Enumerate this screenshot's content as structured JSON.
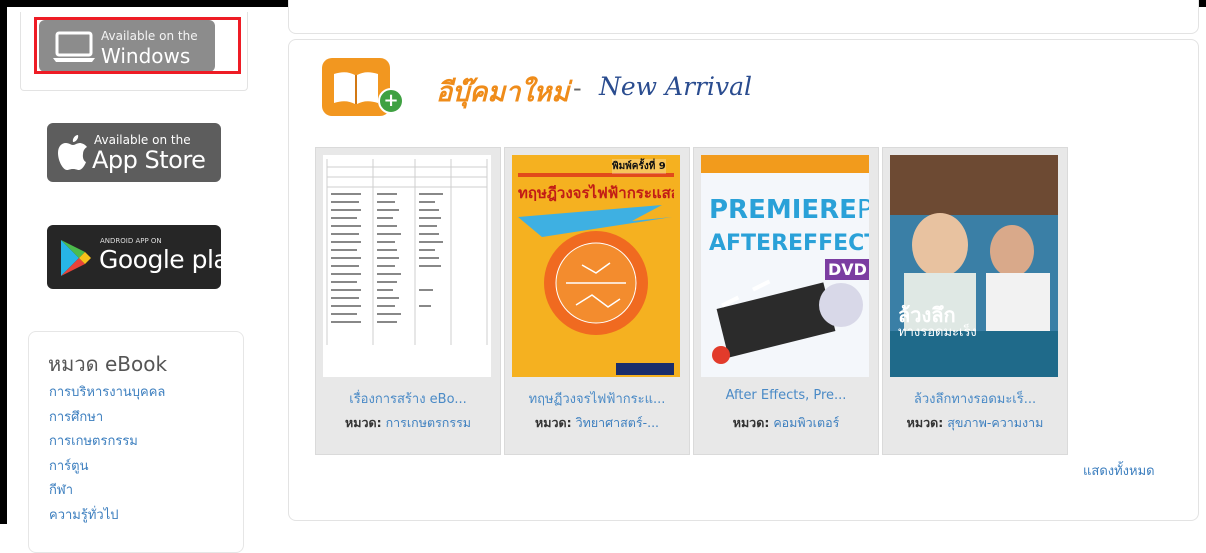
{
  "badges": {
    "windows": {
      "line1": "Available on the",
      "line2": "Windows"
    },
    "appstore": {
      "line1": "Available on the",
      "line2": "App Store"
    },
    "googleplay": {
      "line1": "ANDROID APP ON",
      "line2": "Google play"
    }
  },
  "categories": {
    "title": "หมวด eBook",
    "items": [
      "การบริหารงานบุคคล",
      "การศึกษา",
      "การเกษตรกรรม",
      "การ์ตูน",
      "กีฬา",
      "ความรู้ทั่วไป"
    ]
  },
  "new_arrival": {
    "title_th": "อีบุ๊คมาใหม่",
    "separator": "-",
    "title_en": "New Arrival",
    "show_all": "แสดงทั้งหมด"
  },
  "books": [
    {
      "title": "เรื่องการสร้าง eBo...",
      "category_label": "หมวด:",
      "category": "การเกษตรกรรม"
    },
    {
      "title": "ทฤษฏีวงจรไฟฟ้ากระแ...",
      "category_label": "หมวด:",
      "category": "วิทยาศาสตร์-...",
      "cover": {
        "edition": "พิมพ์ครั้งที่ 9",
        "heading": "ทฤษฎีวงจรไฟฟ้ากระแสสลับ"
      }
    },
    {
      "title": "After Effects, Pre...",
      "category_label": "หมวด:",
      "category": "คอมพิวเตอร์",
      "cover": {
        "line1": "PREMIERE",
        "line1b": "PRO",
        "line2": "AFTEREFFECTS",
        "tag": "DVD"
      }
    },
    {
      "title": "ล้วงลึกทางรอดมะเร็...",
      "category_label": "หมวด:",
      "category": "สุขภาพ-ความงาม",
      "cover": {
        "line1": "ล้วงลึก",
        "line2": "ทางรอดมะเร็ง"
      }
    }
  ],
  "colors": {
    "accent_link": "#3d7fbf",
    "highlight_border": "#ee1c25",
    "section_orange": "#ef8c1a",
    "section_navy": "#2a4c8f"
  }
}
